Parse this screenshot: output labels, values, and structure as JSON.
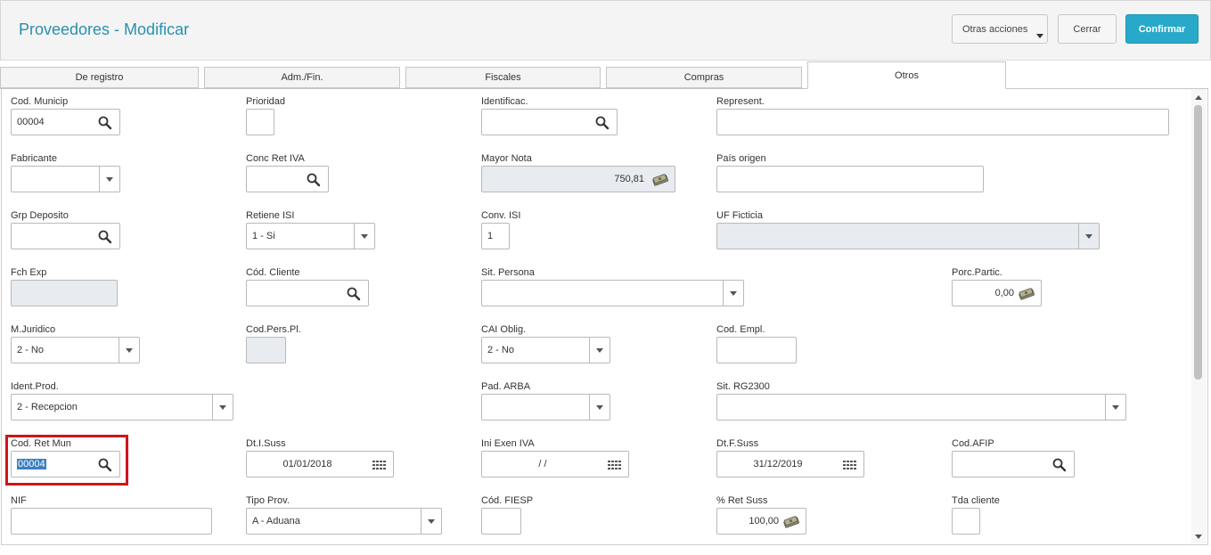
{
  "header": {
    "title": "Proveedores - Modificar",
    "otras_label": "Otras acciones",
    "cerrar_label": "Cerrar",
    "confirmar_label": "Confirmar"
  },
  "tabs": [
    {
      "label": "De registro"
    },
    {
      "label": "Adm./Fin."
    },
    {
      "label": "Fiscales"
    },
    {
      "label": "Compras"
    },
    {
      "label": "Otros"
    }
  ],
  "fields": {
    "cod_municip": {
      "label": "Cod. Municip",
      "value": "00004"
    },
    "prioridad": {
      "label": "Prioridad",
      "value": ""
    },
    "identificac": {
      "label": "Identificac.",
      "value": ""
    },
    "represent": {
      "label": "Represent.",
      "value": ""
    },
    "fabricante": {
      "label": "Fabricante",
      "value": ""
    },
    "conc_ret_iva": {
      "label": "Conc Ret IVA",
      "value": ""
    },
    "mayor_nota": {
      "label": "Mayor Nota",
      "value": "750,81"
    },
    "pais_origen": {
      "label": "País origen",
      "value": ""
    },
    "grp_deposito": {
      "label": "Grp Deposito",
      "value": ""
    },
    "retiene_isi": {
      "label": "Retiene ISI",
      "value": "1 - Si"
    },
    "conv_isi": {
      "label": "Conv. ISI",
      "value": "1"
    },
    "uf_ficticia": {
      "label": "UF Ficticia",
      "value": ""
    },
    "fch_exp": {
      "label": "Fch Exp",
      "value": ""
    },
    "cod_cliente": {
      "label": "Cód. Cliente",
      "value": ""
    },
    "sit_persona": {
      "label": "Sit. Persona",
      "value": ""
    },
    "porc_partic": {
      "label": "Porc.Partic.",
      "value": "0,00"
    },
    "m_juridico": {
      "label": "M.Juridico",
      "value": "2 - No"
    },
    "cod_pers_pl": {
      "label": "Cod.Pers.Pl.",
      "value": ""
    },
    "cai_oblig": {
      "label": "CAI Oblig.",
      "value": "2 - No"
    },
    "cod_empl": {
      "label": "Cod. Empl.",
      "value": ""
    },
    "ident_prod": {
      "label": "Ident.Prod.",
      "value": "2 - Recepcion"
    },
    "pad_arba": {
      "label": "Pad. ARBA",
      "value": ""
    },
    "sit_rg2300": {
      "label": "Sit. RG2300",
      "value": ""
    },
    "cod_ret_mun": {
      "label": "Cod. Ret Mun",
      "value": "00004"
    },
    "dt_i_suss": {
      "label": "Dt.I.Suss",
      "value": "01/01/2018"
    },
    "ini_exen_iva": {
      "label": "Ini Exen IVA",
      "value": "/ /"
    },
    "dt_f_suss": {
      "label": "Dt.F.Suss",
      "value": "31/12/2019"
    },
    "cod_afip": {
      "label": "Cod.AFIP",
      "value": ""
    },
    "nif": {
      "label": "NIF",
      "value": ""
    },
    "tipo_prov": {
      "label": "Tipo Prov.",
      "value": "A - Aduana"
    },
    "cod_fiesp": {
      "label": "Cód. FIESP",
      "value": ""
    },
    "ret_suss": {
      "label": "% Ret Suss",
      "value": "100,00"
    },
    "tda_cliente": {
      "label": "Tda cliente",
      "value": ""
    }
  },
  "colors": {
    "accent": "#2a8fb0",
    "confirm": "#28a9c9",
    "highlight": "#d0141a",
    "readonly": "#e8ebf0"
  }
}
